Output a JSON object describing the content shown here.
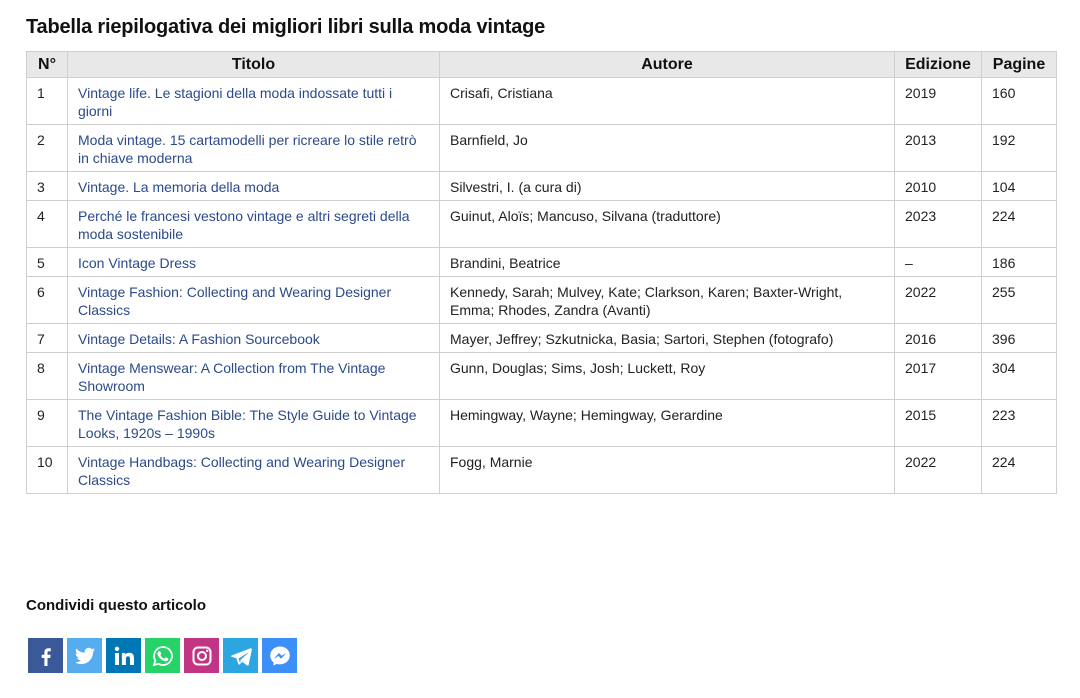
{
  "heading": "Tabella riepilogativa dei migliori libri sulla moda vintage",
  "table": {
    "headers": [
      "N°",
      "Titolo",
      "Autore",
      "Edizione",
      "Pagine"
    ],
    "rows": [
      {
        "num": "1",
        "title": "Vintage life. Le stagioni della moda indossate tutti i giorni",
        "author": "Crisafi, Cristiana",
        "edition": "2019",
        "pages": "160"
      },
      {
        "num": "2",
        "title": "Moda vintage. 15 cartamodelli per ricreare lo stile retrò in chiave moderna",
        "author": "Barnfield, Jo",
        "edition": "2013",
        "pages": "192"
      },
      {
        "num": "3",
        "title": "Vintage. La memoria della moda",
        "author": "Silvestri, I. (a cura di)",
        "edition": "2010",
        "pages": "104"
      },
      {
        "num": "4",
        "title": "Perché le francesi vestono vintage e altri segreti della moda sostenibile",
        "author": "Guinut, Aloïs; Mancuso, Silvana (traduttore)",
        "edition": "2023",
        "pages": "224"
      },
      {
        "num": "5",
        "title": "Icon Vintage Dress",
        "author": "Brandini, Beatrice",
        "edition": "–",
        "pages": "186"
      },
      {
        "num": "6",
        "title": "Vintage Fashion: Collecting and Wearing Designer Classics",
        "author": "Kennedy, Sarah; Mulvey, Kate; Clarkson, Karen; Baxter-Wright, Emma; Rhodes, Zandra (Avanti)",
        "edition": "2022",
        "pages": "255"
      },
      {
        "num": "7",
        "title": "Vintage Details: A Fashion Sourcebook",
        "author": "Mayer, Jeffrey; Szkutnicka, Basia; Sartori, Stephen (fotografo)",
        "edition": "2016",
        "pages": "396"
      },
      {
        "num": "8",
        "title": "Vintage Menswear: A Collection from The Vintage Showroom",
        "author": "Gunn, Douglas; Sims, Josh; Luckett, Roy",
        "edition": "2017",
        "pages": "304"
      },
      {
        "num": "9",
        "title": "The Vintage Fashion Bible: The Style Guide to Vintage Looks, 1920s – 1990s",
        "author": "Hemingway, Wayne; Hemingway, Gerardine",
        "edition": "2015",
        "pages": "223"
      },
      {
        "num": "10",
        "title": "Vintage Handbags: Collecting and Wearing Designer Classics",
        "author": "Fogg, Marnie",
        "edition": "2022",
        "pages": "224"
      }
    ]
  },
  "share": {
    "label": "Condividi questo articolo",
    "buttons": [
      {
        "icon": "facebook-icon",
        "color": "#3b5998"
      },
      {
        "icon": "twitter-icon",
        "color": "#55acee"
      },
      {
        "icon": "linkedin-icon",
        "color": "#0077b5"
      },
      {
        "icon": "whatsapp-icon",
        "color": "#25d366"
      },
      {
        "icon": "instagram-icon",
        "color": "#c13584"
      },
      {
        "icon": "telegram-icon",
        "color": "#2ca5e0"
      },
      {
        "icon": "messenger-icon",
        "color": "#3b8ff6"
      }
    ]
  },
  "colors": {
    "link": "#2b4a8a",
    "header_bg": "#e8e8e8",
    "border": "#cfcfcf"
  }
}
